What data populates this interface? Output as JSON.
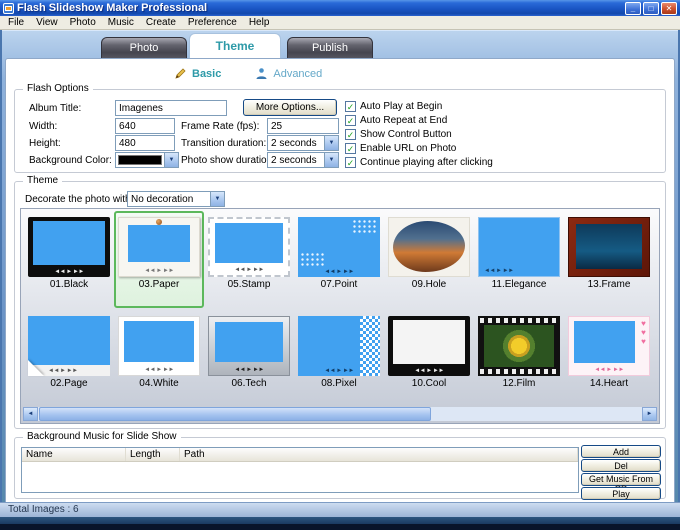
{
  "window": {
    "title": "Flash Slideshow Maker Professional",
    "menus": [
      "File",
      "View",
      "Photo",
      "Music",
      "Create",
      "Preference",
      "Help"
    ],
    "controls": {
      "minimize": "_",
      "maximize": "□",
      "close": "✕"
    }
  },
  "tabs": [
    {
      "label": "Photo"
    },
    {
      "label": "Theme"
    },
    {
      "label": "Publish"
    }
  ],
  "subtabs": [
    {
      "label": "Basic"
    },
    {
      "label": "Advanced"
    }
  ],
  "flash_options": {
    "title": "Flash Options",
    "album_title_label": "Album Title:",
    "album_title_value": "Imagenes",
    "more_options_button": "More Options...",
    "width_label": "Width:",
    "width_value": "640",
    "height_label": "Height:",
    "height_value": "480",
    "background_color_label": "Background Color:",
    "frame_rate_label": "Frame Rate (fps):",
    "frame_rate_value": "25",
    "transition_label": "Transition duration:",
    "transition_value": "2 seconds",
    "photo_show_label": "Photo show duration:",
    "photo_show_value": "2 seconds",
    "checkboxes": [
      {
        "label": "Auto Play at Begin",
        "checked": true
      },
      {
        "label": "Auto Repeat at End",
        "checked": true
      },
      {
        "label": "Show Control Button",
        "checked": true
      },
      {
        "label": "Enable URL on Photo",
        "checked": true
      },
      {
        "label": "Continue playing after clicking",
        "checked": true
      }
    ]
  },
  "theme": {
    "title": "Theme",
    "decorate_label": "Decorate the photo with:",
    "decorate_value": "No decoration",
    "thumbs": [
      {
        "name": "01.Black"
      },
      {
        "name": "03.Paper",
        "selected": true
      },
      {
        "name": "05.Stamp"
      },
      {
        "name": "07.Point"
      },
      {
        "name": "09.Hole"
      },
      {
        "name": "11.Elegance"
      },
      {
        "name": "13.Frame"
      },
      {
        "name": "02.Page"
      },
      {
        "name": "04.White"
      },
      {
        "name": "06.Tech"
      },
      {
        "name": "08.Pixel"
      },
      {
        "name": "10.Cool"
      },
      {
        "name": "12.Film"
      },
      {
        "name": "14.Heart"
      }
    ]
  },
  "music": {
    "title": "Background Music for Slide Show",
    "columns": [
      "Name",
      "Length",
      "Path"
    ],
    "buttons": [
      "Add",
      "Del",
      "Get Music From CD",
      "Play"
    ]
  },
  "status_bar": {
    "total_images": "Total Images : 6"
  },
  "icons": {
    "check": "✓",
    "down_arrow": "▼",
    "left_arrow": "◄",
    "right_arrow": "►",
    "playback": "◄◄ ► ►►",
    "hearts": "♥♥♥"
  }
}
